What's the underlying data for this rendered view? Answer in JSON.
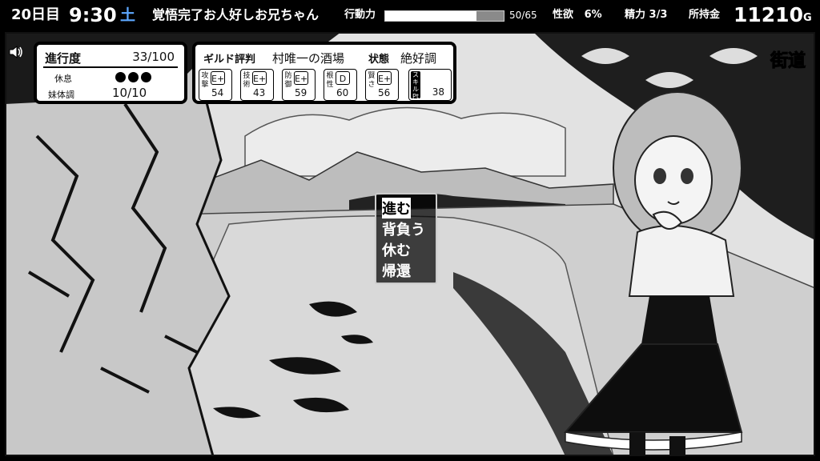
{
  "topbar": {
    "day": "20日目",
    "time": "9:30",
    "weekday": "土",
    "scenario": "覚悟完了お人好しお兄ちゃん",
    "action_label": "行動力",
    "action_value": "50/65",
    "action_fraction": 0.769,
    "lust_label": "性欲",
    "lust_value": "6%",
    "stamina_label": "精力",
    "stamina_value": "3/3",
    "gold_label": "所持金",
    "gold_value": "11210",
    "gold_unit": "G",
    "weekday_color": "#5da8ff"
  },
  "progress": {
    "label": "進行度",
    "value": "33/100",
    "rest_label": "休息",
    "rest_count": 3,
    "condition_label": "妹体調",
    "condition_value": "10/10"
  },
  "guild": {
    "label": "ギルド評判",
    "value": "村唯一の酒場",
    "status_label": "状態",
    "status_value": "絶好調",
    "stats": [
      {
        "label": "攻撃",
        "grade": "E+",
        "value": "54"
      },
      {
        "label": "技術",
        "grade": "E+",
        "value": "43"
      },
      {
        "label": "防御",
        "grade": "E+",
        "value": "59"
      },
      {
        "label": "根性",
        "grade": "D",
        "value": "60"
      },
      {
        "label": "賢さ",
        "grade": "E+",
        "value": "56"
      }
    ],
    "skill_label": "スキルPt",
    "skill_value": "38"
  },
  "menu": {
    "items": [
      "進む",
      "背負う",
      "休む",
      "帰還"
    ],
    "selected": 0
  },
  "location": "街道",
  "icons": {
    "sound": "speaker-icon"
  }
}
